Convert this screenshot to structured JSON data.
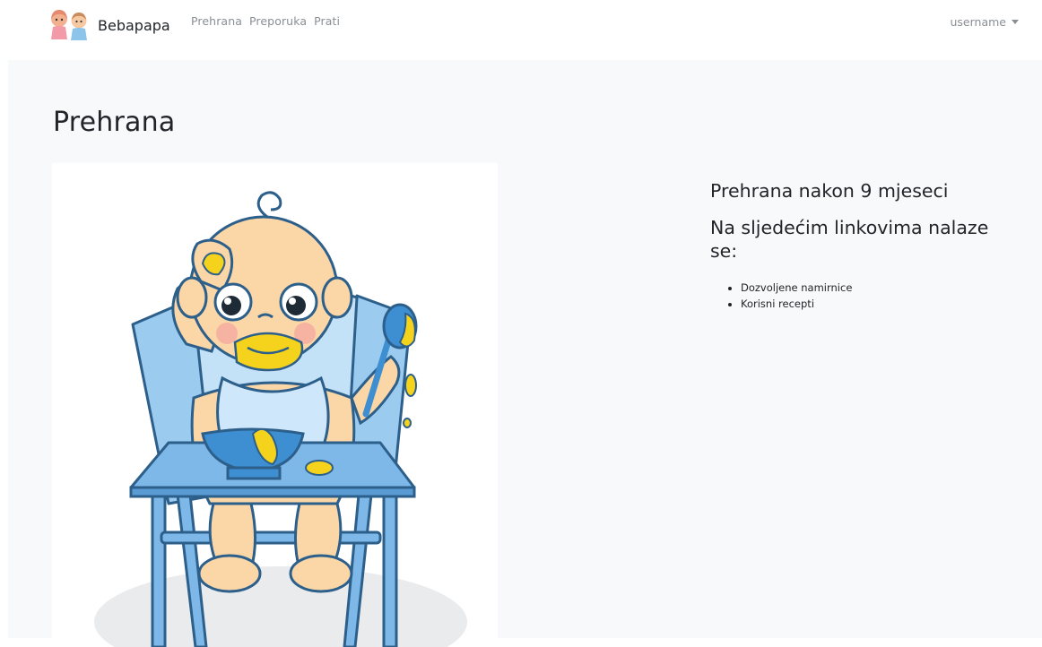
{
  "navbar": {
    "brand_name": "Bebapapa",
    "links": [
      {
        "label": "Prehrana"
      },
      {
        "label": "Preporuka"
      },
      {
        "label": "Prati"
      }
    ],
    "user_menu": {
      "label": "username"
    }
  },
  "main": {
    "page_title": "Prehrana",
    "info": {
      "heading": "Prehrana nakon 9 mjeseci",
      "subheading": "Na sljedećim linkovima nalaze se:",
      "links": [
        {
          "label": "Dozvoljene namirnice"
        },
        {
          "label": "Korisni recepti"
        }
      ]
    }
  },
  "colors": {
    "text": "#212529",
    "nav_link": "#8a8f94",
    "content_bg": "#f8f9fb",
    "chair_blue": "#7db8e8",
    "food_yellow": "#f5d21c",
    "skin": "#fbd7a8"
  }
}
